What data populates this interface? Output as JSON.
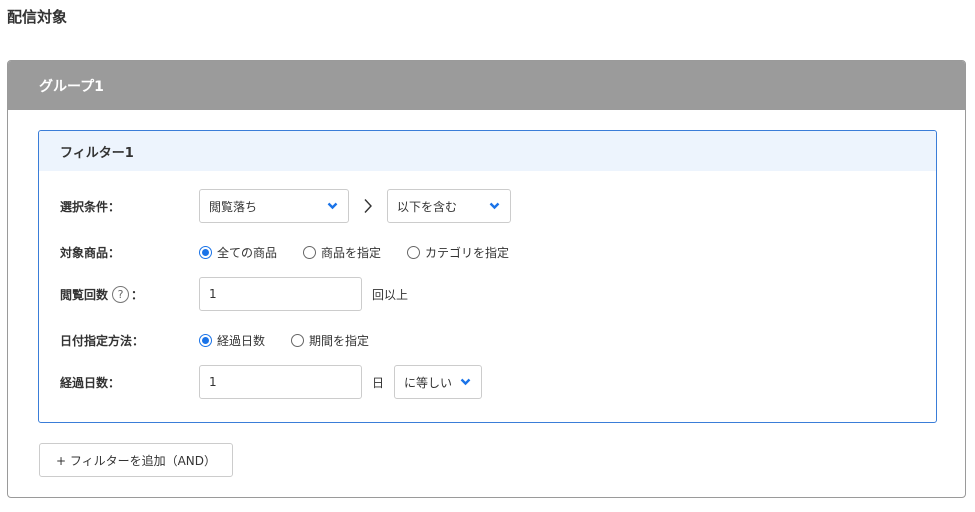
{
  "page": {
    "title": "配信対象"
  },
  "group": {
    "title": "グループ1"
  },
  "filter": {
    "title": "フィルター1",
    "rows": {
      "condition": {
        "label": "選択条件：",
        "select1_value": "閲覧落ち",
        "select2_value": "以下を含む"
      },
      "target_product": {
        "label": "対象商品：",
        "options": [
          "全ての商品",
          "商品を指定",
          "カテゴリを指定"
        ],
        "selected": "全ての商品"
      },
      "view_count": {
        "label_prefix": "閲覧回数",
        "help_glyph": "?",
        "label_suffix": "：",
        "value": "1",
        "suffix": "回以上"
      },
      "date_method": {
        "label": "日付指定方法：",
        "options": [
          "経過日数",
          "期間を指定"
        ],
        "selected": "経過日数"
      },
      "elapsed_days": {
        "label": "経過日数：",
        "value": "1",
        "unit": "日",
        "select_value": "に等しい"
      }
    }
  },
  "add_filter_button": {
    "label": "+ フィルターを追加（AND）"
  },
  "colors": {
    "accent": "#1a73e8",
    "group_header": "#9b9b9b",
    "filter_border": "#3a7dd8",
    "filter_header_bg": "#edf4fd"
  }
}
